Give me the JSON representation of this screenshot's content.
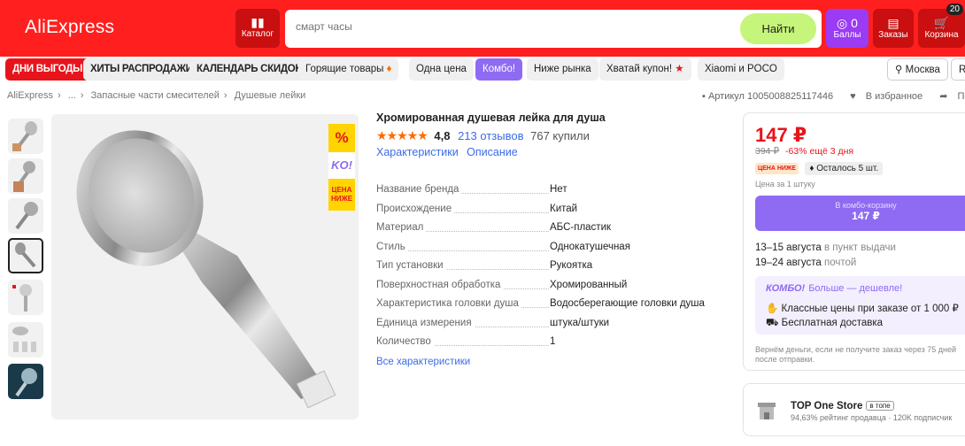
{
  "header": {
    "logo": "AliExpress",
    "catalog_label": "Каталог",
    "search_placeholder": "смарт часы",
    "search_button": "Найти",
    "points_count": "0",
    "points_label": "Баллы",
    "orders_label": "Заказы",
    "cart_label": "Корзина",
    "cart_count": "20",
    "accent_color": "#ff1f1f"
  },
  "promo_nav": [
    {
      "label": "ДНИ ВЫГОДЫ"
    },
    {
      "label": "ХИТЫ РАСПРОДАЖИ"
    },
    {
      "label": "КАЛЕНДАРЬ СКИДОК"
    },
    {
      "label": "Горящие товары"
    },
    {
      "label": "Одна цена"
    },
    {
      "label": "Комбо!"
    },
    {
      "label": "Ниже рынка"
    },
    {
      "label": "Хватай купон!"
    },
    {
      "label": "Xiaomi и POCO"
    }
  ],
  "location": {
    "city": "Москва",
    "extra": "R"
  },
  "breadcrumb": [
    "AliExpress",
    "...",
    "Запасные части смесителей",
    "Душевые лейки"
  ],
  "article": "Артикул 1005008825117446",
  "favorite_label": "В избранное",
  "share_label": "По",
  "badges": {
    "percent": "%",
    "ko": "KO!",
    "low": "ЦЕНА НИЖЕ"
  },
  "product": {
    "title": "Хромированная душевая лейка для душа",
    "stars": "★★★★★",
    "rating": "4,8",
    "reviews": "213 отзывов",
    "bought": "767 купили",
    "tab_characteristics": "Характеристики",
    "tab_description": "Описание",
    "specs": [
      {
        "name": "Название бренда",
        "value": "Нет"
      },
      {
        "name": "Происхождение",
        "value": "Китай"
      },
      {
        "name": "Материал",
        "value": "АБС-пластик"
      },
      {
        "name": "Стиль",
        "value": "Однокатушечная"
      },
      {
        "name": "Тип установки",
        "value": "Рукоятка"
      },
      {
        "name": "Поверхностная обработка",
        "value": "Хромированный"
      },
      {
        "name": "Характеристика головки душа",
        "value": "Водосберегающие головки душа"
      },
      {
        "name": "Единица измерения",
        "value": "штука/штуки"
      },
      {
        "name": "Количество",
        "value": "1"
      }
    ],
    "all_specs_link": "Все характеристики"
  },
  "buybox": {
    "price": "147 ₽",
    "old_price": "394 ₽",
    "discount": "-63% ещё 3 дня",
    "tag_low": "ЦЕНА НИЖЕ",
    "left_in_stock": "Осталось 5 шт.",
    "per_unit": "Цена за 1 штуку",
    "combo_line1": "В комбо-корзину",
    "combo_line2": "147 ₽",
    "delivery_pickup_date": "13–15 августа",
    "delivery_pickup_text": "в пункт выдачи",
    "delivery_post_date": "19–24 августа",
    "delivery_post_text": "почтой",
    "combo_title": "КОМБО!",
    "combo_tagline": "Больше — дешевле!",
    "combo_line_a": "Классные цены при заказе от 1 000 ₽",
    "combo_line_b": "Бесплатная доставка",
    "refund": "Вернём деньги, если не получите заказ через 75 дней после отправки."
  },
  "store": {
    "name": "TOP One Store",
    "tag": "в топе",
    "sub": "94,63% рейтинг продавца · 120K подписчик"
  }
}
